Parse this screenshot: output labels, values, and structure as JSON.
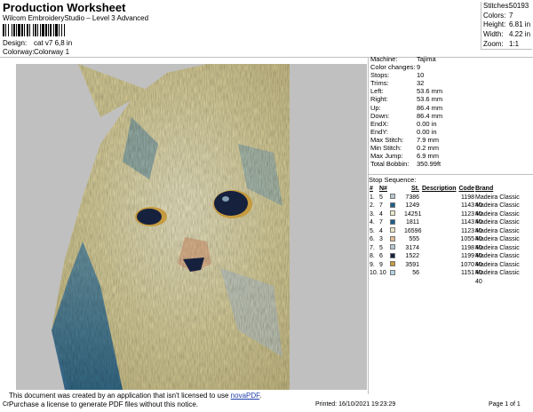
{
  "header": {
    "title": "Production Worksheet",
    "subtitle": "Wilcom EmbroideryStudio – Level 3 Advanced",
    "design_label": "Design:",
    "design_value": "cat v7 6,8 in",
    "colorway_label": "Colorway:",
    "colorway_value": "Colorway 1"
  },
  "top_stats": [
    {
      "label": "Stitches:",
      "value": "50193"
    },
    {
      "label": "Colors:",
      "value": "7"
    },
    {
      "label": "Height:",
      "value": "6.81 in"
    },
    {
      "label": "Width:",
      "value": "4.22 in"
    },
    {
      "label": "Zoom:",
      "value": "1:1"
    }
  ],
  "machine_info": [
    {
      "label": "Machine:",
      "value": "Tajima"
    },
    {
      "label": "Color changes:",
      "value": "9"
    },
    {
      "label": "Stops:",
      "value": "10"
    },
    {
      "label": "Trims:",
      "value": "32"
    },
    {
      "label": "Left:",
      "value": "53.6 mm"
    },
    {
      "label": "Right:",
      "value": "53.6 mm"
    },
    {
      "label": "Up:",
      "value": "86.4 mm"
    },
    {
      "label": "Down:",
      "value": "86.4 mm"
    },
    {
      "label": "EndX:",
      "value": "0.00 in"
    },
    {
      "label": "EndY:",
      "value": "0.00 in"
    },
    {
      "label": "Max Stitch:",
      "value": "7.9 mm"
    },
    {
      "label": "Min Stitch:",
      "value": "0.2 mm"
    },
    {
      "label": "Max Jump:",
      "value": "6.9 mm"
    },
    {
      "label": "Total Bobbin:",
      "value": "350.99ft"
    }
  ],
  "stop_sequence": {
    "title": "Stop Sequence:",
    "headers": [
      "#",
      "N#",
      "St.",
      "Description",
      "Code",
      "Brand"
    ],
    "rows": [
      {
        "n": "1.",
        "nn": "5",
        "color": "#b7c7cf",
        "st": "7386",
        "desc": "",
        "code": "1198",
        "brand": "Madeira Classic 40"
      },
      {
        "n": "2.",
        "nn": "7",
        "color": "#1d5e8a",
        "st": "1249",
        "desc": "",
        "code": "1143",
        "brand": "Madeira Classic 40"
      },
      {
        "n": "3.",
        "nn": "4",
        "color": "#ece7c4",
        "st": "14251",
        "desc": "",
        "code": "1123",
        "brand": "Madeira Classic 40"
      },
      {
        "n": "4.",
        "nn": "7",
        "color": "#1d5e8a",
        "st": "1811",
        "desc": "",
        "code": "1143",
        "brand": "Madeira Classic 40"
      },
      {
        "n": "5.",
        "nn": "4",
        "color": "#ece7c4",
        "st": "16596",
        "desc": "",
        "code": "1123",
        "brand": "Madeira Classic 40"
      },
      {
        "n": "6.",
        "nn": "3",
        "color": "#e3b991",
        "st": "555",
        "desc": "",
        "code": "1055",
        "brand": "Madeira Classic 40"
      },
      {
        "n": "7.",
        "nn": "5",
        "color": "#b7c7cf",
        "st": "3174",
        "desc": "",
        "code": "1198",
        "brand": "Madeira Classic 40"
      },
      {
        "n": "8.",
        "nn": "6",
        "color": "#16213e",
        "st": "1522",
        "desc": "",
        "code": "1199",
        "brand": "Madeira Classic 40"
      },
      {
        "n": "9.",
        "nn": "9",
        "color": "#c69a3e",
        "st": "3591",
        "desc": "",
        "code": "1070",
        "brand": "Madeira Classic 40"
      },
      {
        "n": "10.",
        "nn": "10",
        "color": "#b2d5e3",
        "st": "56",
        "desc": "",
        "code": "1151",
        "brand": "Madeira Classic 40"
      }
    ]
  },
  "notice": {
    "line1": "This document was created by an application that isn't licensed to use ",
    "link": "novaPDF",
    "line1_end": ".",
    "line2": "Purchase a license to generate PDF files without this notice."
  },
  "footer": {
    "left": "Cr",
    "printed": "Printed: 16/10/2021 19:23:29",
    "page": "Page 1 of 1"
  },
  "design_colors": {
    "canvas_bg": "#c0c0c0",
    "fur_cream": "#d9cf9a",
    "fur_light": "#ece7c4",
    "fur_blue": "#1d5e8a",
    "fur_grey": "#b7c7cf",
    "eye_gold": "#c69a3e",
    "eye_dark": "#16213e",
    "nose_peach": "#e3b991"
  }
}
